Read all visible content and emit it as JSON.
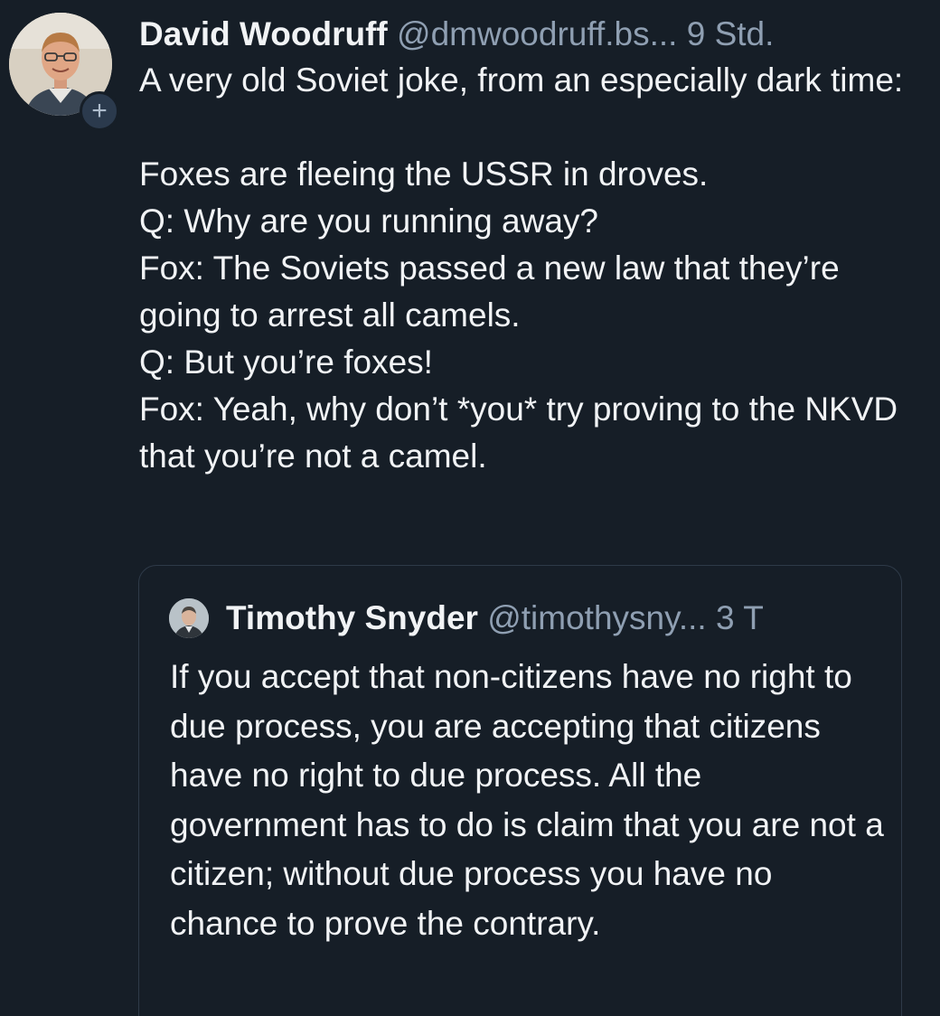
{
  "post": {
    "author_name": "David Woodruff",
    "author_handle": "@dmwoodruff.bs...",
    "time": "9 Std.",
    "follow_symbol": "+",
    "text": "A very old Soviet joke, from an especially dark time:\n\nFoxes are fleeing the USSR in droves.\nQ: Why are you running away?\nFox: The Soviets passed a new law that they’re going to arrest all camels.\nQ: But you’re foxes!\nFox: Yeah, why don’t *you* try proving to the NKVD that you’re not a camel."
  },
  "quote": {
    "author_name": "Timothy Snyder",
    "author_handle": "@timothysny...",
    "time": "3 T",
    "text": "If you accept that non-citizens have no right to due process, you are accepting that citizens have no right to due process. All the government has to do is claim that you are not a citizen; without due process you have no chance to prove the contrary."
  },
  "colors": {
    "background": "#161e27",
    "text": "#f1f3f5",
    "muted": "#8f9fb2",
    "border": "#2e3a48"
  },
  "icons": {
    "follow": "plus-icon",
    "author_avatar": "avatar",
    "quote_avatar": "avatar"
  }
}
